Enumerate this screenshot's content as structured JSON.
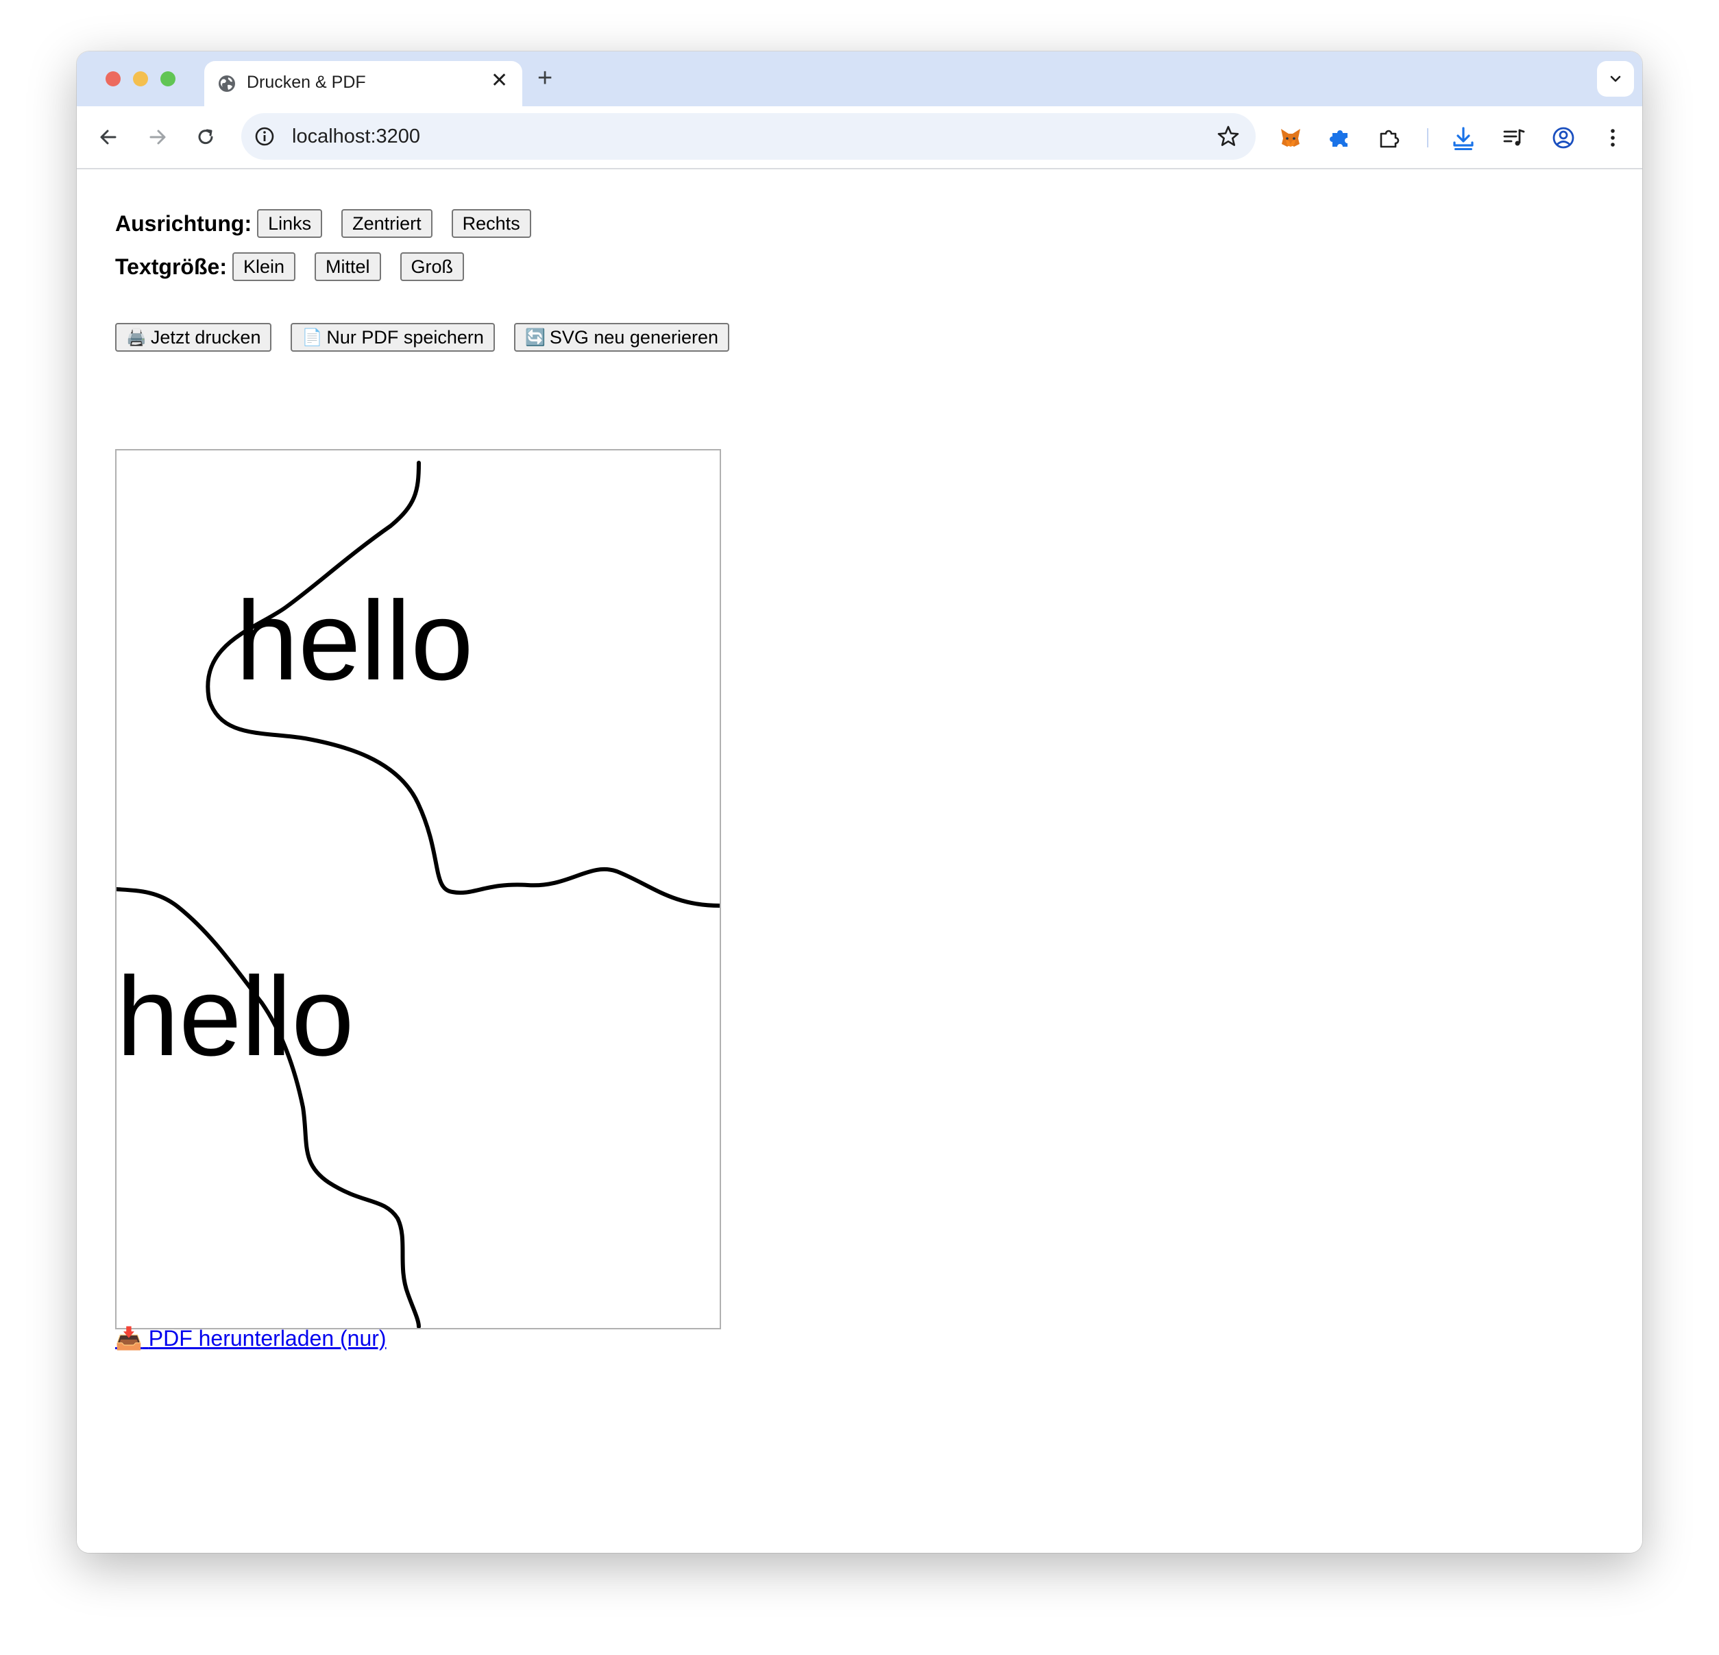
{
  "browser": {
    "tab_title": "Drucken & PDF",
    "tab_close": "✕",
    "new_tab": "+",
    "url": "localhost:3200"
  },
  "controls": {
    "alignment": {
      "label": "Ausrichtung:",
      "options": [
        "Links",
        "Zentriert",
        "Rechts"
      ]
    },
    "text_size": {
      "label": "Textgröße:",
      "options": [
        "Klein",
        "Mittel",
        "Groß"
      ]
    }
  },
  "actions": {
    "print": {
      "icon": "🖨️",
      "label": "Jetzt drucken"
    },
    "save_pdf": {
      "icon": "📄",
      "label": "Nur PDF speichern"
    },
    "regenerate_svg": {
      "icon": "🔄",
      "label": "SVG neu generieren"
    }
  },
  "preview": {
    "words": [
      "hello",
      "hello"
    ]
  },
  "download_link": {
    "icon": "📥",
    "label": "PDF herunterladen (nur)"
  },
  "colors": {
    "tabbar": "#d6e2f7",
    "omnibox": "#edf2fa",
    "link": "#0000ee",
    "download_accent": "#1a73e8"
  }
}
